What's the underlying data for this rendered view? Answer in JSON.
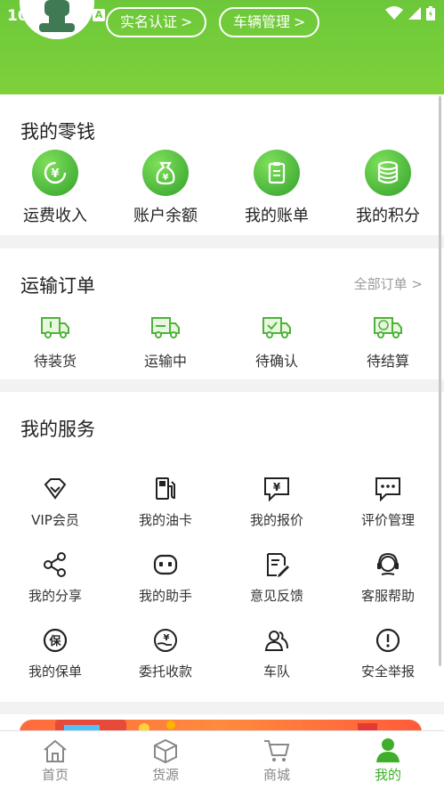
{
  "status_bar": {
    "time": "10:5"
  },
  "header": {
    "chips": [
      {
        "label": "实名认证",
        "chevron": ">"
      },
      {
        "label": "车辆管理",
        "chevron": ">"
      }
    ]
  },
  "wallet": {
    "title": "我的零钱",
    "items": [
      {
        "label": "运费收入",
        "icon": "yuan-arrows-icon"
      },
      {
        "label": "账户余额",
        "icon": "money-bag-icon"
      },
      {
        "label": "我的账单",
        "icon": "clipboard-icon"
      },
      {
        "label": "我的积分",
        "icon": "coin-stack-icon"
      }
    ]
  },
  "orders": {
    "title": "运输订单",
    "more_label": "全部订单 >",
    "items": [
      {
        "label": "待装货",
        "icon": "truck-load-icon"
      },
      {
        "label": "运输中",
        "icon": "truck-moving-icon"
      },
      {
        "label": "待确认",
        "icon": "truck-check-icon"
      },
      {
        "label": "待结算",
        "icon": "truck-yuan-icon"
      }
    ]
  },
  "services": {
    "title": "我的服务",
    "items": [
      {
        "label": "VIP会员",
        "icon": "diamond-icon"
      },
      {
        "label": "我的油卡",
        "icon": "fuel-pump-icon"
      },
      {
        "label": "我的报价",
        "icon": "price-chat-icon"
      },
      {
        "label": "评价管理",
        "icon": "comment-icon"
      },
      {
        "label": "我的分享",
        "icon": "share-icon"
      },
      {
        "label": "我的助手",
        "icon": "assistant-icon"
      },
      {
        "label": "意见反馈",
        "icon": "feedback-icon"
      },
      {
        "label": "客服帮助",
        "icon": "headset-icon"
      },
      {
        "label": "我的保单",
        "icon": "insurance-icon"
      },
      {
        "label": "委托收款",
        "icon": "hand-yuan-icon"
      },
      {
        "label": "车队",
        "icon": "team-icon"
      },
      {
        "label": "安全举报",
        "icon": "alert-icon"
      }
    ]
  },
  "tabbar": {
    "items": [
      {
        "label": "首页",
        "icon": "home-icon",
        "active": false
      },
      {
        "label": "货源",
        "icon": "box-icon",
        "active": false
      },
      {
        "label": "商城",
        "icon": "cart-icon",
        "active": false
      },
      {
        "label": "我的",
        "icon": "user-icon",
        "active": true
      }
    ]
  },
  "colors": {
    "brand_green": "#6cc83a",
    "active_tab": "#3fae2a",
    "banner_orange": "#ff6a3d"
  }
}
